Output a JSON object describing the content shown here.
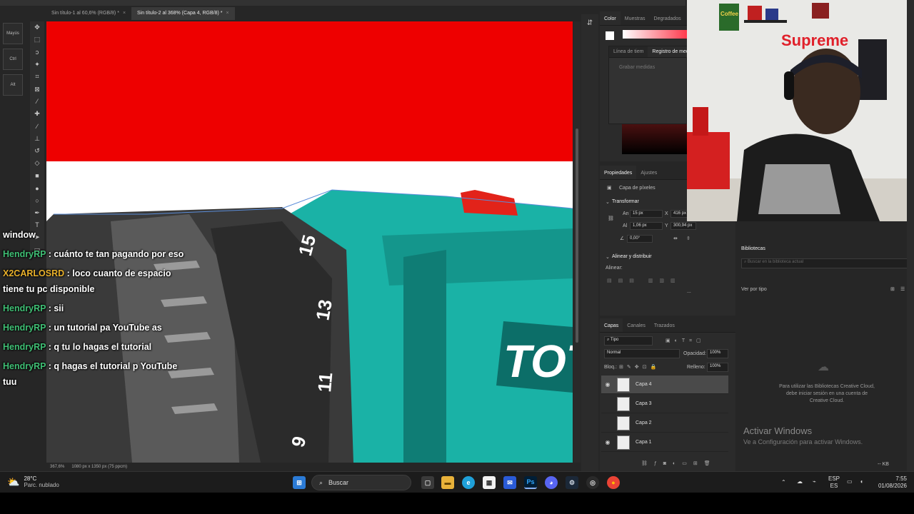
{
  "document_tabs": [
    {
      "label": "Sin título-1 al 60,6% (RGB/8) *",
      "active": false
    },
    {
      "label": "Sin título-2 al 368% (Capa 4, RGB/8) *",
      "active": true
    }
  ],
  "modifier_keys": [
    "Mayús",
    "Ctrl",
    "Alt"
  ],
  "tools": [
    "move-tool",
    "marquee-tool",
    "lasso-tool",
    "magic-wand-tool",
    "crop-tool",
    "frame-tool",
    "eyedropper-tool",
    "healing-tool",
    "brush-tool",
    "stamp-tool",
    "history-brush-tool",
    "eraser-tool",
    "gradient-tool",
    "blur-tool",
    "dodge-tool",
    "pen-tool",
    "type-tool",
    "path-select-tool",
    "shape-tool"
  ],
  "canvas": {
    "top_color": "#ee0000",
    "bottom_color": "#ffffff",
    "drill_color": "#19b3a8",
    "brand_text": "TOTAL"
  },
  "status": {
    "zoom": "367,6%",
    "doc_size": "1080 px x 1350 px (75 ppcm)"
  },
  "chat": [
    {
      "user": "",
      "message": "window"
    },
    {
      "user": "HendryRP",
      "message": ": cuánto te tan pagando por eso"
    },
    {
      "user": "X2CARLOSRD",
      "message": ": loco cuanto de espacio tiene tu pc disponible",
      "gold": true
    },
    {
      "user": "HendryRP",
      "message": ": sii"
    },
    {
      "user": "HendryRP",
      "message": ": un tutorial pa YouTube as"
    },
    {
      "user": "HendryRP",
      "message": ": q tu lo hagas el tutorial"
    },
    {
      "user": "HendryRP",
      "message": ": q hagas el tutorial p YouTube tuu"
    }
  ],
  "color_panel": {
    "tabs": [
      "Color",
      "Muestras",
      "Degradados"
    ],
    "sub_tabs": [
      "Línea de tiem",
      "Registro de medi"
    ],
    "record_label": "Grabar medidas"
  },
  "properties": {
    "tabs": [
      "Propiedades",
      "Ajustes"
    ],
    "layer_kind": "Capa de píxeles",
    "transform_title": "Transformar",
    "an_label": "An",
    "an_value": "15 px",
    "x_label": "X",
    "x_value": "416 px",
    "al_label": "Al",
    "al_value": "1,06 px",
    "y_label": "Y",
    "y_value": "300,94 px",
    "angle_value": "0,00°",
    "align_title": "Alinear y distribuir",
    "align_label": "Alinear:",
    "more": "..."
  },
  "layers_panel": {
    "tabs": [
      "Capas",
      "Canales",
      "Trazados"
    ],
    "filter": "Tipo",
    "blend_mode": "Normal",
    "opacity_label": "Opacidad:",
    "opacity_value": "100%",
    "lock_label": "Bloq.:",
    "fill_label": "Relleno:",
    "fill_value": "100%",
    "layers": [
      {
        "name": "Capa 4",
        "visible": true,
        "selected": true
      },
      {
        "name": "Capa 3",
        "visible": false,
        "selected": false
      },
      {
        "name": "Capa 2",
        "visible": false,
        "selected": false
      },
      {
        "name": "Capa 1",
        "visible": true,
        "selected": false
      }
    ]
  },
  "libraries": {
    "title": "Bibliotecas",
    "search_placeholder": "Buscar en la biblioteca actual",
    "view_by": "Ver por tipo",
    "message": "Para utilizar las Bibliotecas Creative Cloud, debe iniciar sesión en una cuenta de Creative Cloud.",
    "size": "-- KB"
  },
  "webcam": {
    "brand": "Supreme",
    "sign": "Coffee"
  },
  "activation": {
    "title": "Activar Windows",
    "subtitle": "Ve a Configuración para activar Windows."
  },
  "taskbar": {
    "temperature": "28°C",
    "weather": "Parc. nublado",
    "search_label": "Buscar",
    "language_top": "ESP",
    "language_bottom": "ES",
    "time": "7:55",
    "date": "01/08/2026"
  }
}
